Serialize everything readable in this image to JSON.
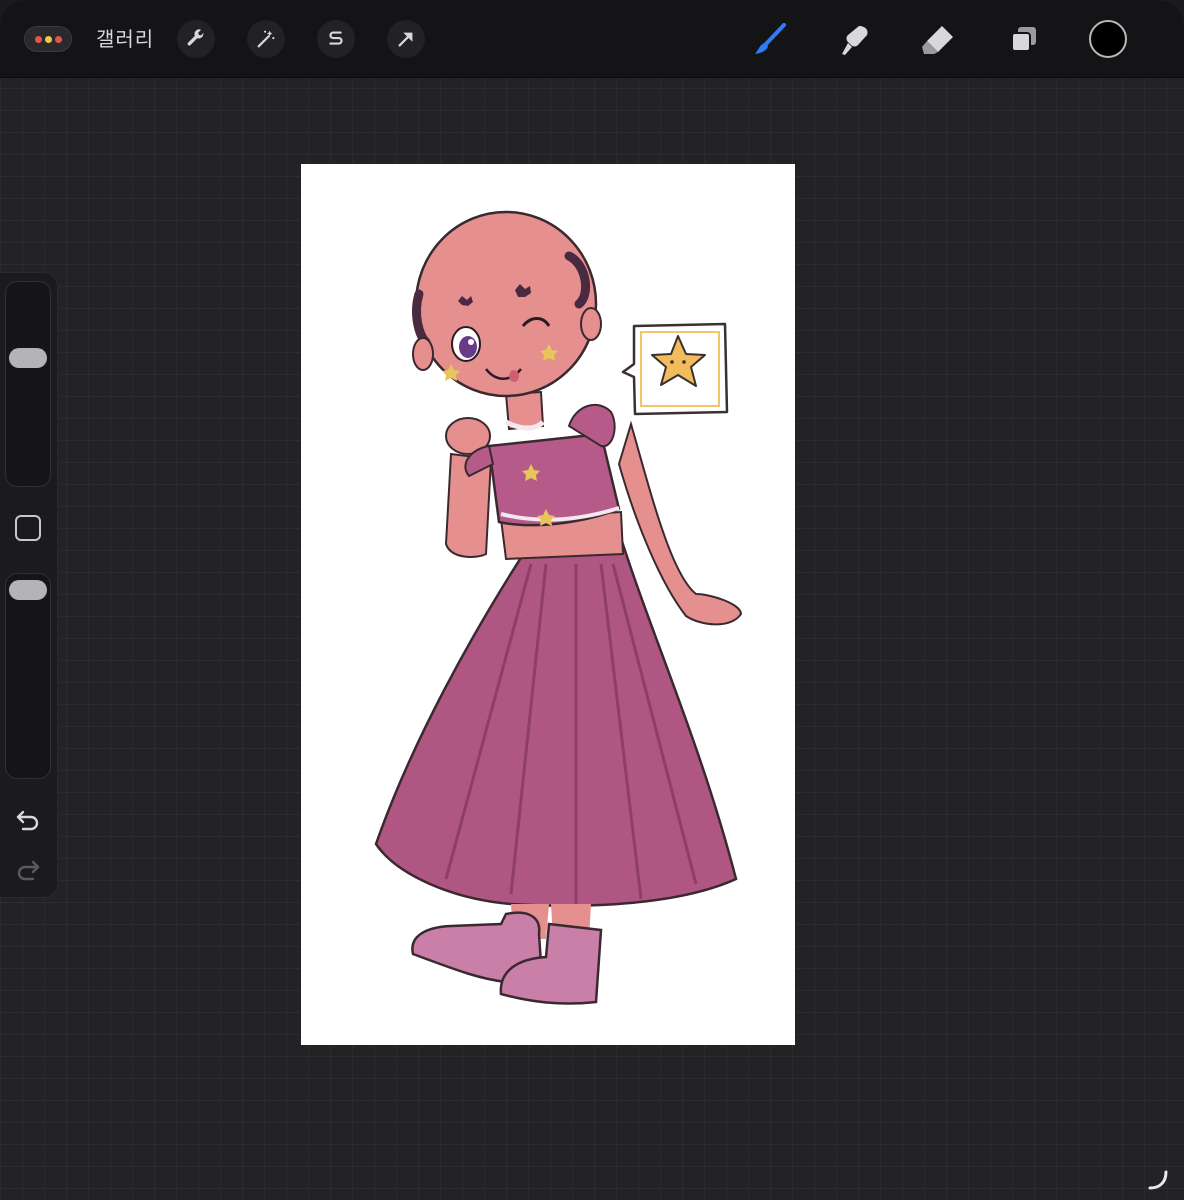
{
  "toolbar": {
    "gallery_label": "갤러리",
    "left_tools": [
      {
        "icon": "wrench-icon",
        "name": "actions"
      },
      {
        "icon": "magic-wand-icon",
        "name": "adjustments"
      },
      {
        "icon": "selection-s-icon",
        "name": "selection"
      },
      {
        "icon": "transform-arrow-icon",
        "name": "transform"
      }
    ],
    "right_tools": [
      {
        "icon": "brush-icon",
        "name": "paint",
        "active": true
      },
      {
        "icon": "smudge-icon",
        "name": "smudge",
        "active": false
      },
      {
        "icon": "eraser-icon",
        "name": "erase",
        "active": false
      },
      {
        "icon": "layers-icon",
        "name": "layers",
        "active": false
      }
    ],
    "current_color": "#000000",
    "accent_color": "#2f7cf6"
  },
  "sidebar": {
    "brush_size_level": 0.36,
    "opacity_level": 0.05,
    "undo_icon": "undo-icon",
    "redo_icon": "redo-icon"
  },
  "canvas": {
    "background": "#ffffff",
    "artwork": "character-illustration"
  }
}
